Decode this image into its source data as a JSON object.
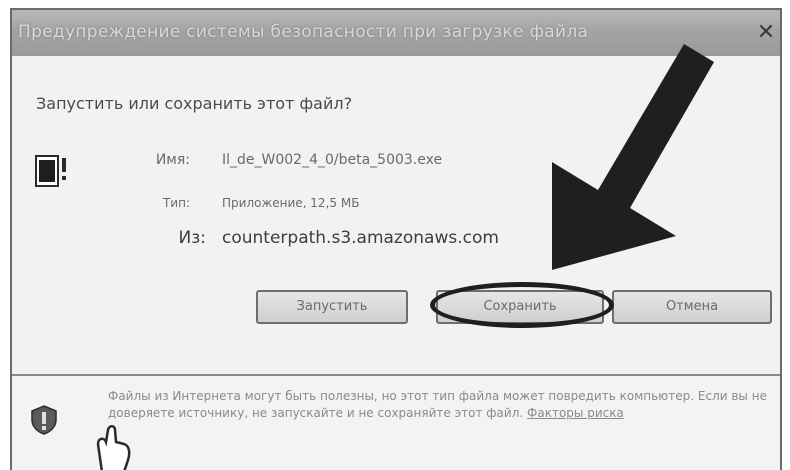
{
  "window": {
    "title": "Предупреждение системы безопасности при загрузке файла"
  },
  "dialog": {
    "question": "Запустить или сохранить этот файл?",
    "file": {
      "name_label": "Имя:",
      "name_value": "Il_de_W002_4_0/beta_5003.exe",
      "type_label": "Тип:",
      "type_value": "Приложение, 12,5 МБ",
      "from_label": "Из:",
      "from_value": "counterpath.s3.amazonaws.com"
    },
    "buttons": {
      "run": "Запустить",
      "save": "Сохранить",
      "cancel": "Отмена"
    },
    "warning": {
      "text": "Файлы из Интернета могут быть полезны, но этот тип файла может повредить компьютер. Если вы не доверяете источнику, не запускайте и не сохраняйте этот файл.",
      "link": "Факторы риска"
    }
  },
  "icons": {
    "close": "close-icon",
    "file": "application-file-icon",
    "warning": "shield-warning-icon",
    "annotation": "annotation-arrow-icon",
    "cursor": "hand-cursor-icon"
  },
  "colors": {
    "annotation": "#1f1f1f",
    "titlebar": "#a4a4a4",
    "background": "#f2f2f2"
  }
}
